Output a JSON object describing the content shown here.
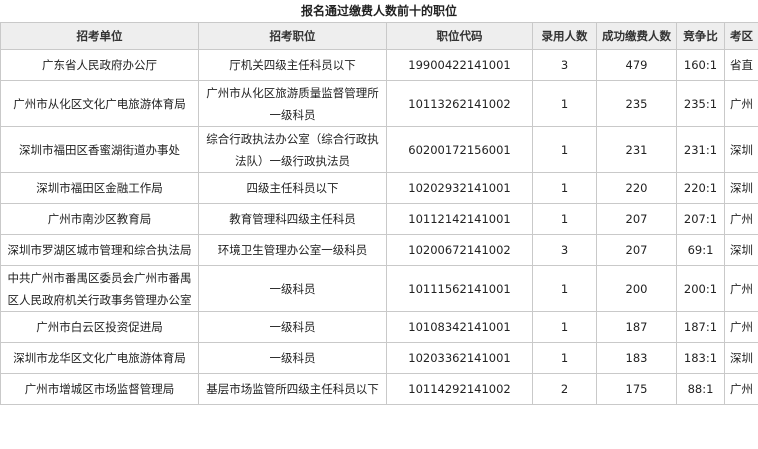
{
  "title": "报名通过缴费人数前十的职位",
  "headers": [
    "招考单位",
    "招考职位",
    "职位代码",
    "录用人数",
    "成功缴费人数",
    "竞争比",
    "考区"
  ],
  "rows": [
    {
      "unit": "广东省人民政府办公厅",
      "position": "厅机关四级主任科员以下",
      "code": "19900422141001",
      "hires": "3",
      "paid": "479",
      "ratio": "160:1",
      "area": "省直",
      "tall": false
    },
    {
      "unit": "广州市从化区文化广电旅游体育局",
      "position": "广州市从化区旅游质量监督管理所一级科员",
      "code": "10113262141002",
      "hires": "1",
      "paid": "235",
      "ratio": "235:1",
      "area": "广州",
      "tall": true
    },
    {
      "unit": "深圳市福田区香蜜湖街道办事处",
      "position": "综合行政执法办公室（综合行政执法队）一级行政执法员",
      "code": "60200172156001",
      "hires": "1",
      "paid": "231",
      "ratio": "231:1",
      "area": "深圳",
      "tall": true
    },
    {
      "unit": "深圳市福田区金融工作局",
      "position": "四级主任科员以下",
      "code": "10202932141001",
      "hires": "1",
      "paid": "220",
      "ratio": "220:1",
      "area": "深圳",
      "tall": false
    },
    {
      "unit": "广州市南沙区教育局",
      "position": "教育管理科四级主任科员",
      "code": "10112142141001",
      "hires": "1",
      "paid": "207",
      "ratio": "207:1",
      "area": "广州",
      "tall": false
    },
    {
      "unit": "深圳市罗湖区城市管理和综合执法局",
      "position": "环境卫生管理办公室一级科员",
      "code": "10200672141002",
      "hires": "3",
      "paid": "207",
      "ratio": "69:1",
      "area": "深圳",
      "tall": false
    },
    {
      "unit": "中共广州市番禺区委员会广州市番禺区人民政府机关行政事务管理办公室",
      "position": "一级科员",
      "code": "10111562141001",
      "hires": "1",
      "paid": "200",
      "ratio": "200:1",
      "area": "广州",
      "tall": true
    },
    {
      "unit": "广州市白云区投资促进局",
      "position": "一级科员",
      "code": "10108342141001",
      "hires": "1",
      "paid": "187",
      "ratio": "187:1",
      "area": "广州",
      "tall": false
    },
    {
      "unit": "深圳市龙华区文化广电旅游体育局",
      "position": "一级科员",
      "code": "10203362141001",
      "hires": "1",
      "paid": "183",
      "ratio": "183:1",
      "area": "深圳",
      "tall": false
    },
    {
      "unit": "广州市增城区市场监督管理局",
      "position": "基层市场监管所四级主任科员以下",
      "code": "10114292141002",
      "hires": "2",
      "paid": "175",
      "ratio": "88:1",
      "area": "广州",
      "tall": false
    }
  ]
}
